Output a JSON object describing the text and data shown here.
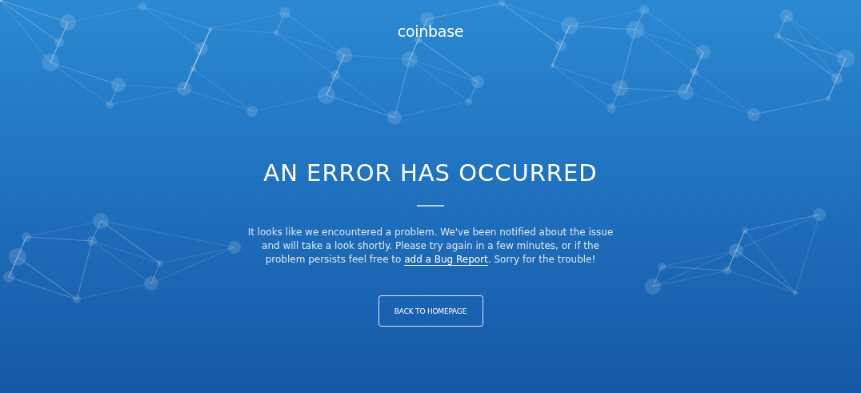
{
  "logo": "coinbase",
  "heading": "AN ERROR HAS OCCURRED",
  "message": {
    "before": "It looks like we encountered a problem. We've been notified about the issue and will take a look shortly. Please try again in a few minutes, or if the problem persists feel free to ",
    "link": "add a Bug Report",
    "after": ". Sorry for the trouble!"
  },
  "button": "BACK TO HOMEPAGE"
}
